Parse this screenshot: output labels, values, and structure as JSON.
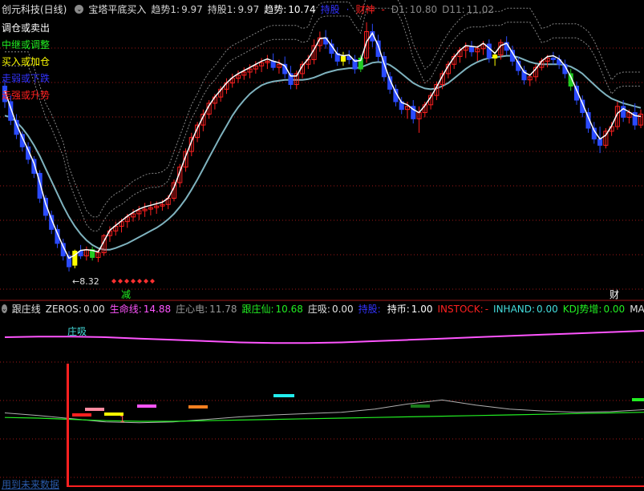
{
  "main_header": {
    "title": "创元科技(日线)",
    "indicator": "宝塔平底买入",
    "items": [
      {
        "label": "趋势1:",
        "value": "9.97",
        "label_color": "#d0d0d0",
        "value_color": "#d0d0d0"
      },
      {
        "label": "持股1:",
        "value": "9.97",
        "label_color": "#d0d0d0",
        "value_color": "#d0d0d0"
      },
      {
        "label": "趋势:",
        "value": "10.74",
        "label_color": "#ffffff",
        "value_color": "#ffffff"
      },
      {
        "label": "持股",
        "value": "",
        "label_color": "#3333ff",
        "value_color": "#3333ff"
      },
      {
        "label": "·",
        "value": "",
        "label_color": "#3333ff",
        "value_color": "#3333ff"
      },
      {
        "label": "财神",
        "value": "",
        "label_color": "#ff2020",
        "value_color": "#ff2020"
      },
      {
        "label": "-",
        "value": "",
        "label_color": "#ff2020",
        "value_color": "#ff2020"
      },
      {
        "label": "D1:",
        "value": "10.80",
        "label_color": "#888888",
        "value_color": "#888888"
      },
      {
        "label": "D11:",
        "value": "11.02",
        "label_color": "#888888",
        "value_color": "#888888"
      }
    ]
  },
  "legend": [
    {
      "text": "调仓或卖出",
      "color": "#ffffff"
    },
    {
      "text": "中继或调整",
      "color": "#22ee22"
    },
    {
      "text": "买入或加仓",
      "color": "#ffff00"
    },
    {
      "text": "走弱或下跌",
      "color": "#3333ff"
    },
    {
      "text": "走强或升势",
      "color": "#ff2020"
    }
  ],
  "annotations": {
    "low_label": "8.32",
    "signal_jian": "减",
    "signal_cai": "财",
    "zhuangxi": "庄吸",
    "sub_one": "1",
    "future_data": "用到未来数据"
  },
  "sub_header": {
    "title": "跟庄线",
    "items": [
      {
        "label": "ZEROS:",
        "value": "0.00",
        "label_color": "#e0e0e0",
        "value_color": "#e0e0e0"
      },
      {
        "label": "生命线:",
        "value": "14.88",
        "label_color": "#ff55ff",
        "value_color": "#ff55ff"
      },
      {
        "label": "庄心电:",
        "value": "11.78",
        "label_color": "#999999",
        "value_color": "#999999"
      },
      {
        "label": "跟庄仙:",
        "value": "10.68",
        "label_color": "#22ee22",
        "value_color": "#22ee22"
      },
      {
        "label": "庄吸:",
        "value": "0.00",
        "label_color": "#e0e0e0",
        "value_color": "#e0e0e0"
      },
      {
        "label": "持股:",
        "value": "",
        "label_color": "#3333ff",
        "value_color": "#3333ff"
      },
      {
        "label": "持币:",
        "value": "1.00",
        "label_color": "#ffffff",
        "value_color": "#ffffff"
      },
      {
        "label": "INSTOCK:",
        "value": "-",
        "label_color": "#ff2020",
        "value_color": "#ff2020"
      },
      {
        "label": "INHAND:",
        "value": "0.00",
        "label_color": "#44dddd",
        "value_color": "#44dddd"
      },
      {
        "label": "KDJ势增:",
        "value": "0.00",
        "label_color": "#22ee22",
        "value_color": "#22ee22"
      },
      {
        "label": "MAC",
        "value": "",
        "label_color": "#e0e0e0",
        "value_color": "#e0e0e0"
      }
    ]
  },
  "colors": {
    "up": "#ff2020",
    "down": "#2b4bff",
    "neutral_green": "#22cc22",
    "buy_yellow": "#ffff00",
    "ma": "#7fb3bf",
    "tower": "#dddddd",
    "grid": "#a01818",
    "dashed_bands": "#888888",
    "life_line": "#ff55ff",
    "zx_line": "#22ee22",
    "zxd_line": "#b0b0b0"
  },
  "chart_data": {
    "type": "candlestick",
    "ylim": [
      8.0,
      11.6
    ],
    "low_marker": 8.32,
    "candles": [
      [
        10.7,
        10.78,
        10.42,
        10.5
      ],
      [
        10.5,
        10.58,
        10.2,
        10.26
      ],
      [
        10.26,
        10.34,
        10.02,
        10.08
      ],
      [
        10.08,
        10.12,
        9.86,
        9.92
      ],
      [
        9.92,
        9.98,
        9.7,
        9.76
      ],
      [
        9.76,
        9.8,
        9.52,
        9.58
      ],
      [
        9.58,
        9.62,
        9.2,
        9.26
      ],
      [
        9.26,
        9.3,
        8.98,
        9.04
      ],
      [
        9.04,
        9.1,
        8.8,
        8.86
      ],
      [
        8.86,
        8.92,
        8.62,
        8.68
      ],
      [
        8.68,
        8.74,
        8.46,
        8.52
      ],
      [
        8.52,
        8.58,
        8.32,
        8.38
      ],
      [
        8.4,
        8.6,
        8.36,
        8.58
      ],
      [
        8.58,
        8.66,
        8.48,
        8.52
      ],
      [
        8.52,
        8.64,
        8.46,
        8.6
      ],
      [
        8.6,
        8.64,
        8.46,
        8.5
      ],
      [
        8.5,
        8.6,
        8.44,
        8.56
      ],
      [
        8.56,
        8.8,
        8.52,
        8.78
      ],
      [
        8.78,
        8.9,
        8.7,
        8.84
      ],
      [
        8.84,
        8.96,
        8.78,
        8.9
      ],
      [
        8.9,
        9.0,
        8.82,
        8.96
      ],
      [
        8.96,
        9.06,
        8.88,
        9.02
      ],
      [
        9.02,
        9.12,
        8.96,
        9.06
      ],
      [
        9.06,
        9.16,
        8.98,
        9.1
      ],
      [
        9.1,
        9.2,
        9.02,
        9.12
      ],
      [
        9.12,
        9.22,
        9.04,
        9.14
      ],
      [
        9.14,
        9.22,
        9.06,
        9.16
      ],
      [
        9.16,
        9.24,
        9.1,
        9.18
      ],
      [
        9.18,
        9.3,
        9.12,
        9.26
      ],
      [
        9.26,
        9.5,
        9.22,
        9.46
      ],
      [
        9.46,
        9.7,
        9.4,
        9.66
      ],
      [
        9.66,
        9.9,
        9.6,
        9.86
      ],
      [
        9.86,
        10.1,
        9.8,
        10.04
      ],
      [
        10.04,
        10.24,
        9.98,
        10.2
      ],
      [
        10.2,
        10.4,
        10.12,
        10.34
      ],
      [
        10.34,
        10.52,
        10.28,
        10.48
      ],
      [
        10.48,
        10.6,
        10.4,
        10.56
      ],
      [
        10.56,
        10.7,
        10.5,
        10.66
      ],
      [
        10.66,
        10.8,
        10.6,
        10.74
      ],
      [
        10.74,
        10.86,
        10.68,
        10.8
      ],
      [
        10.8,
        10.9,
        10.74,
        10.84
      ],
      [
        10.84,
        10.94,
        10.78,
        10.88
      ],
      [
        10.88,
        10.98,
        10.8,
        10.92
      ],
      [
        10.92,
        11.02,
        10.86,
        10.96
      ],
      [
        10.96,
        11.06,
        10.88,
        11.0
      ],
      [
        11.0,
        11.1,
        10.92,
        11.02
      ],
      [
        11.02,
        11.12,
        10.9,
        10.94
      ],
      [
        10.94,
        11.04,
        10.86,
        10.98
      ],
      [
        10.98,
        11.08,
        10.8,
        10.86
      ],
      [
        10.86,
        10.96,
        10.66,
        10.72
      ],
      [
        10.72,
        10.9,
        10.66,
        10.86
      ],
      [
        10.86,
        11.02,
        10.8,
        10.98
      ],
      [
        10.98,
        11.1,
        10.92,
        11.04
      ],
      [
        11.04,
        11.3,
        10.98,
        11.22
      ],
      [
        11.22,
        11.4,
        11.14,
        11.32
      ],
      [
        11.32,
        11.42,
        11.18,
        11.24
      ],
      [
        11.24,
        11.3,
        11.06,
        11.12
      ],
      [
        11.12,
        11.2,
        10.96,
        11.02
      ],
      [
        11.02,
        11.14,
        10.96,
        11.08
      ],
      [
        11.08,
        11.16,
        10.98,
        11.04
      ],
      [
        11.04,
        11.1,
        10.86,
        10.92
      ],
      [
        10.92,
        11.1,
        10.88,
        11.06
      ],
      [
        11.06,
        11.52,
        11.0,
        11.4
      ],
      [
        11.4,
        11.5,
        11.2,
        11.28
      ],
      [
        11.28,
        11.36,
        11.02,
        11.08
      ],
      [
        11.08,
        11.14,
        10.76,
        10.82
      ],
      [
        10.82,
        10.88,
        10.6,
        10.66
      ],
      [
        10.66,
        10.72,
        10.44,
        10.5
      ],
      [
        10.5,
        10.56,
        10.34,
        10.4
      ],
      [
        10.4,
        10.5,
        10.28,
        10.44
      ],
      [
        10.44,
        10.52,
        10.22,
        10.28
      ],
      [
        10.28,
        10.44,
        10.1,
        10.36
      ],
      [
        10.36,
        10.5,
        10.3,
        10.46
      ],
      [
        10.46,
        10.62,
        10.4,
        10.58
      ],
      [
        10.58,
        10.76,
        10.52,
        10.72
      ],
      [
        10.72,
        10.9,
        10.66,
        10.86
      ],
      [
        10.86,
        11.02,
        10.8,
        10.98
      ],
      [
        10.98,
        11.12,
        10.92,
        11.08
      ],
      [
        11.08,
        11.2,
        11.0,
        11.16
      ],
      [
        11.16,
        11.26,
        11.06,
        11.2
      ],
      [
        11.2,
        11.28,
        11.08,
        11.14
      ],
      [
        11.14,
        11.22,
        11.02,
        11.18
      ],
      [
        11.18,
        11.28,
        11.1,
        11.24
      ],
      [
        11.24,
        11.3,
        11.0,
        11.06
      ],
      [
        11.06,
        11.14,
        10.96,
        11.1
      ],
      [
        11.1,
        11.3,
        11.04,
        11.26
      ],
      [
        11.26,
        11.34,
        11.1,
        11.16
      ],
      [
        11.16,
        11.22,
        10.96,
        11.02
      ],
      [
        11.02,
        11.08,
        10.84,
        10.9
      ],
      [
        10.9,
        10.96,
        10.72,
        10.78
      ],
      [
        10.78,
        10.86,
        10.7,
        10.82
      ],
      [
        10.82,
        10.98,
        10.76,
        10.94
      ],
      [
        10.94,
        11.06,
        10.9,
        11.02
      ],
      [
        11.02,
        11.1,
        10.94,
        11.06
      ],
      [
        11.06,
        11.14,
        10.98,
        11.04
      ],
      [
        11.04,
        11.1,
        10.92,
        10.98
      ],
      [
        10.98,
        11.04,
        10.8,
        10.86
      ],
      [
        10.86,
        10.92,
        10.64,
        10.7
      ],
      [
        10.7,
        10.76,
        10.46,
        10.52
      ],
      [
        10.52,
        10.58,
        10.3,
        10.36
      ],
      [
        10.36,
        10.42,
        10.1,
        10.16
      ],
      [
        10.16,
        10.24,
        9.96,
        10.02
      ],
      [
        10.02,
        10.18,
        9.84,
        9.94
      ],
      [
        9.94,
        10.16,
        9.9,
        10.12
      ],
      [
        10.12,
        10.24,
        10.06,
        10.18
      ],
      [
        10.18,
        10.5,
        10.14,
        10.44
      ],
      [
        10.44,
        10.52,
        10.24,
        10.3
      ],
      [
        10.3,
        10.4,
        10.22,
        10.36
      ],
      [
        10.36,
        10.48,
        10.14,
        10.2
      ],
      [
        10.2,
        10.4,
        10.16,
        10.34
      ]
    ],
    "ma": [
      10.32,
      10.3,
      10.24,
      10.16,
      10.06,
      9.94,
      9.8,
      9.64,
      9.48,
      9.32,
      9.16,
      9.02,
      8.9,
      8.8,
      8.72,
      8.66,
      8.62,
      8.6,
      8.6,
      8.62,
      8.65,
      8.68,
      8.72,
      8.76,
      8.8,
      8.84,
      8.88,
      8.93,
      8.99,
      9.06,
      9.15,
      9.25,
      9.37,
      9.5,
      9.64,
      9.78,
      9.92,
      10.06,
      10.19,
      10.32,
      10.43,
      10.52,
      10.6,
      10.66,
      10.71,
      10.74,
      10.76,
      10.77,
      10.78,
      10.78,
      10.78,
      10.78,
      10.79,
      10.81,
      10.84,
      10.87,
      10.89,
      10.91,
      10.92,
      10.93,
      10.93,
      10.94,
      10.97,
      11.0,
      11.01,
      11.0,
      10.97,
      10.92,
      10.86,
      10.8,
      10.74,
      10.7,
      10.67,
      10.66,
      10.67,
      10.7,
      10.74,
      10.8,
      10.86,
      10.92,
      10.97,
      11.01,
      11.04,
      11.06,
      11.07,
      11.08,
      11.09,
      11.09,
      11.07,
      11.04,
      11.01,
      10.99,
      10.98,
      10.98,
      10.98,
      10.98,
      10.97,
      10.95,
      10.91,
      10.86,
      10.79,
      10.72,
      10.65,
      10.59,
      10.54,
      10.51,
      10.48,
      10.46,
      10.44,
      10.42
    ],
    "sub": {
      "life_line": [
        22.9,
        23.0,
        23.0,
        22.9,
        22.7,
        22.5,
        22.3,
        22.1,
        22.0,
        22.0,
        22.1,
        22.3,
        22.5,
        22.7,
        22.9,
        23.1,
        23.3,
        23.5,
        23.7,
        23.9
      ],
      "zx_line": [
        10.5,
        10.4,
        10.2,
        10.0,
        9.9,
        9.9,
        10.0,
        10.1,
        10.2,
        10.3,
        10.4,
        10.5,
        10.6,
        10.7,
        10.8,
        10.9,
        11.0,
        11.1,
        11.2,
        11.3
      ],
      "zxd_line": [
        11.2,
        10.8,
        10.3,
        9.8,
        9.7,
        9.8,
        10.2,
        10.6,
        10.9,
        11.1,
        11.3,
        11.8,
        12.6,
        13.2,
        12.4,
        11.8,
        11.5,
        11.3,
        11.4,
        11.7
      ]
    }
  }
}
